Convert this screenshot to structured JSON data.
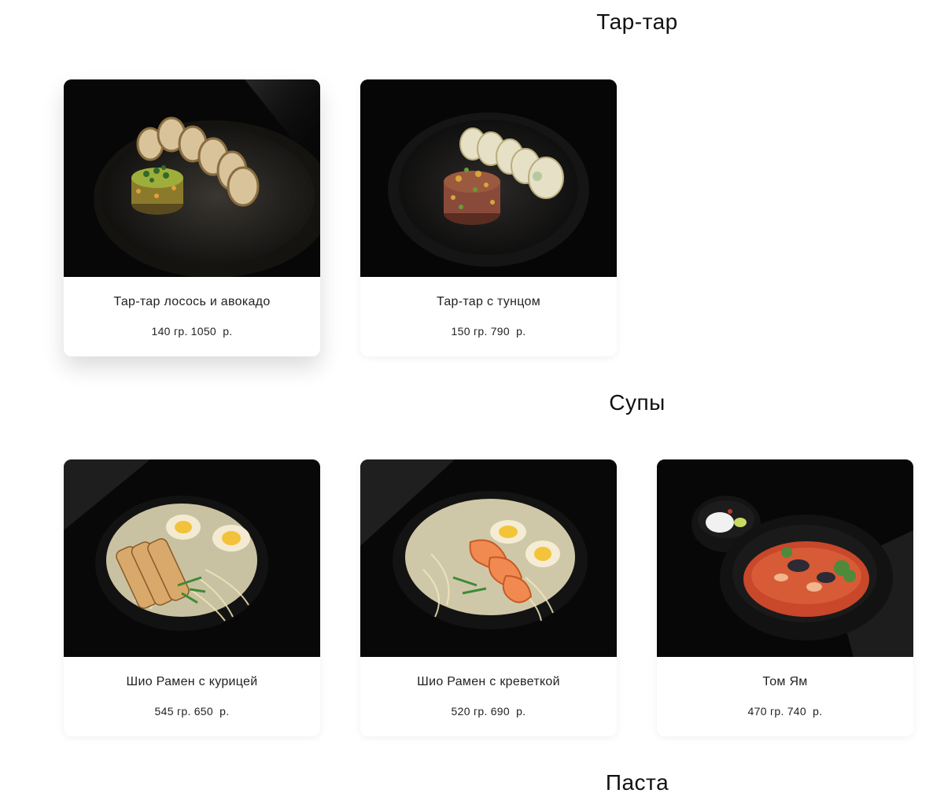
{
  "sections": [
    {
      "title": "Тар-тар",
      "items": [
        {
          "name": "Тар-тар лосось и авокадо",
          "weight": "140 гр.",
          "price": "1050",
          "currency": "р.",
          "image": "salmon-avocado-tartare-photo"
        },
        {
          "name": "Тар-тар с тунцом",
          "weight": "150 гр.",
          "price": "790",
          "currency": "р.",
          "image": "tuna-tartare-photo"
        }
      ]
    },
    {
      "title": "Супы",
      "items": [
        {
          "name": "Шио Рамен с курицей",
          "weight": "545 гр.",
          "price": "650",
          "currency": "р.",
          "image": "chicken-ramen-photo"
        },
        {
          "name": "Шио Рамен с креветкой",
          "weight": "520 гр.",
          "price": "690",
          "currency": "р.",
          "image": "shrimp-ramen-photo"
        },
        {
          "name": "Том Ям",
          "weight": "470 гр.",
          "price": "740",
          "currency": "р.",
          "image": "tom-yum-photo"
        }
      ]
    },
    {
      "title": "Паста",
      "items": []
    }
  ],
  "colors": {
    "page_background": "#ffffff",
    "card_background": "#ffffff",
    "photo_background": "#0a0a0a",
    "text": "#222222"
  }
}
